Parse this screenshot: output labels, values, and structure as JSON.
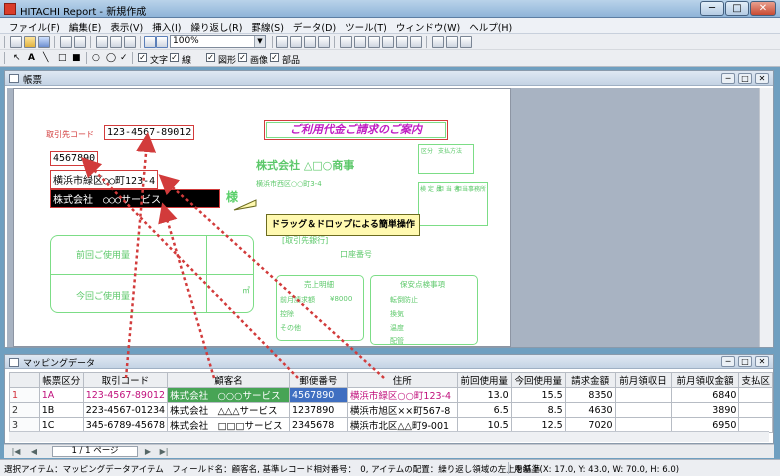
{
  "window": {
    "title": "HITACHI Report - 新規作成",
    "min_label": "─",
    "max_label": "□",
    "close_label": "✕"
  },
  "menu": [
    "ファイル(F)",
    "編集(E)",
    "表示(V)",
    "挿入(I)",
    "繰り返し(R)",
    "罫線(S)",
    "データ(D)",
    "ツール(T)",
    "ウィンドウ(W)",
    "ヘルプ(H)"
  ],
  "toolbar": {
    "zoom_value": "100%",
    "zoom_arrow": "▼",
    "checkbox_labels": {
      "text": "文字",
      "line": "線",
      "shape": "図形",
      "image": "画像",
      "parts": "部品"
    },
    "checked_mark": "✓",
    "tool_glyphs": {
      "pointer": "↖",
      "text_tool": "A",
      "line_tool": "╲",
      "rect_tool": "□",
      "rect2_tool": "■",
      "ellipse_tool": "○",
      "rounded_tool": "◯",
      "check_tool": "✓"
    }
  },
  "report_pane": {
    "title": "帳票",
    "form": {
      "customer_code_label": "取引先コード",
      "customer_code": "123-4567-89012",
      "postal_code": "4567890",
      "address": "横浜市緑区○○町123-4",
      "customer_name": "株式会社　○○○サービス",
      "honorific": "様",
      "heading": "ご利用代金ご請求のご案内",
      "company": "株式会社 △□○商事",
      "company_address": "横浜市西区○○町3-4",
      "bank_label": "[取引先銀行]",
      "account_label": "口座番号",
      "prev_usage": "前回ご使用量",
      "curr_usage": "今回ご使用量",
      "unit": "㎥",
      "sales_box_title": "売上明細",
      "sales_labels": [
        "前月請求額",
        "控除",
        "その他"
      ],
      "sales_value": "¥8000",
      "notes_title": "保安点検事項",
      "notes_items": [
        "転倒防止",
        "換気",
        "温度",
        "配管"
      ],
      "box1_labels": [
        "区分",
        "支払方法"
      ],
      "box2_labels": [
        "検 定 員",
        "担 当 者",
        "担当事務所"
      ]
    },
    "callout": "ドラッグ＆ドロップによる簡単操作"
  },
  "mapping_pane": {
    "title": "マッピングデータ",
    "columns": [
      "",
      "帳票区分",
      "取引コード",
      "顧客名",
      "郵便番号",
      "住所",
      "前回使用量",
      "今回使用量",
      "請求金額",
      "前月領収日",
      "前月領収金額",
      "支払区"
    ],
    "rows": [
      [
        "1",
        "1A",
        "123-4567-89012",
        "株式会社　○○○サービス",
        "4567890",
        "横浜市緑区○○町123-4",
        "13.0",
        "15.5",
        "8350",
        "",
        "6840",
        ""
      ],
      [
        "2",
        "1B",
        "223-4567-01234",
        "株式会社　△△△サービス",
        "1237890",
        "横浜市旭区××町567-8",
        "6.5",
        "8.5",
        "4630",
        "",
        "3890",
        ""
      ],
      [
        "3",
        "1C",
        "345-6789-45678",
        "株式会社　□□□サービス",
        "2345678",
        "横浜市北区△△町9-001",
        "10.5",
        "12.5",
        "7020",
        "",
        "6950",
        ""
      ]
    ]
  },
  "pagenav": {
    "page_label": "1 / 1 ページ",
    "first": "|◀",
    "prev": "◀",
    "next": "▶",
    "last": "▶|"
  },
  "statusbar": {
    "left": "選択アイテム：マッピングデータアイテム　フィールド名：顧客名, 基準レコード相対番号：　0, アイテムの配置：繰り返し領域の左上を基準",
    "right": "用紙上(X: 17.0, Y: 43.0, W: 70.0, H: 6.0)"
  },
  "colors": {
    "accent_red": "#d23b3b",
    "form_green": "#5bd06a",
    "heading_magenta": "#c01dc4",
    "selection_blue": "#3f6fc1",
    "callout_yellow": "#fff9b0"
  }
}
